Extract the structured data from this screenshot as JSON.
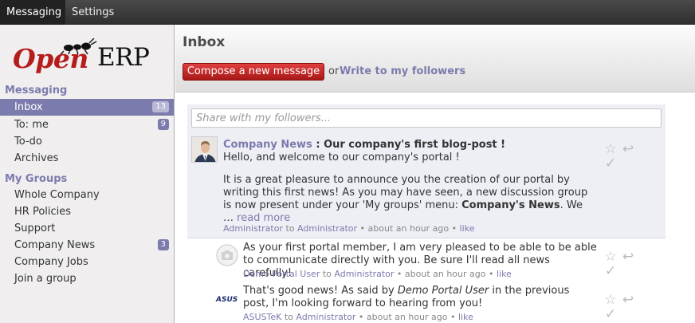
{
  "topbar": {
    "tabs": [
      {
        "label": "Messaging"
      },
      {
        "label": "Settings"
      }
    ]
  },
  "logo": {
    "text_open": "Open",
    "text_erp": "ERP"
  },
  "sidebar": {
    "messaging_title": "Messaging",
    "messaging_items": [
      {
        "label": "Inbox",
        "count": "13"
      },
      {
        "label": "To: me",
        "count": "9"
      },
      {
        "label": "To-do"
      },
      {
        "label": "Archives"
      }
    ],
    "groups_title": "My Groups",
    "group_items": [
      {
        "label": "Whole Company"
      },
      {
        "label": "HR Policies"
      },
      {
        "label": "Support"
      },
      {
        "label": "Company News",
        "count": "3"
      },
      {
        "label": "Company Jobs"
      },
      {
        "label": "Join a group"
      }
    ]
  },
  "header": {
    "title": "Inbox",
    "compose_label": "Compose a new message",
    "or_text": "or",
    "write_followers_label": "Write to my followers"
  },
  "composer": {
    "placeholder": "Share with my followers..."
  },
  "main_message": {
    "author": "Company News",
    "separator": " : ",
    "subject": "Our company's first blog-post !",
    "greeting": "Hello, and welcome to our company's portal !",
    "body_text_1": "It is a great pleasure to announce you the creation of our portal by writing this first news! As you may have seen, a new discussion group is now present under your 'My groups' menu: ",
    "body_bold": "Company's News",
    "body_text_2": ". We",
    "ellipsis": "… ",
    "read_more": "read more",
    "meta_from": "Administrator",
    "meta_to": " to ",
    "meta_recipient": "Administrator",
    "meta_time": " • about an hour ago • ",
    "meta_like": "like"
  },
  "replies": [
    {
      "body": "As your first portal member, I am very pleased to be able to be able to communicate directly with you. Be sure I'll read all news carefully!",
      "from": "Demo Portal User",
      "to": " to ",
      "recipient": "Administrator",
      "time": " • about an hour ago • ",
      "like": "like"
    },
    {
      "body_1": "That's good news! As said by ",
      "body_italic": "Demo Portal User",
      "body_2": " in the previous post, I'm looking forward to hearing from you!",
      "avatar_text": "ASUS",
      "from": "ASUSTeK",
      "to": " to ",
      "recipient": "Administrator",
      "time": " • about an hour ago • ",
      "like": "like"
    }
  ],
  "icons": {
    "star": "star-icon",
    "reply": "reply-icon",
    "check": "check-icon"
  }
}
